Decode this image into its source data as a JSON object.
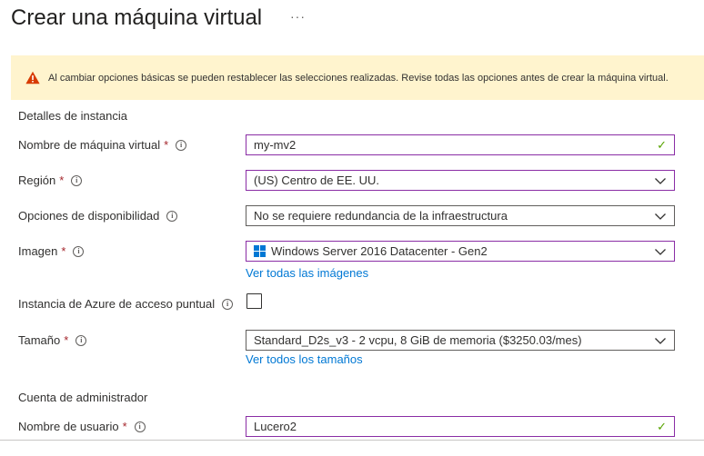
{
  "page": {
    "title": "Crear una máquina virtual",
    "more_label": "···"
  },
  "warning": {
    "text": "Al cambiar opciones básicas se pueden restablecer las selecciones realizadas. Revise todas las opciones antes de crear la máquina virtual.",
    "icon": "warning-icon",
    "background_color": "#fff4ce",
    "icon_color": "#d83b01"
  },
  "instance_details": {
    "section_title": "Detalles de instancia",
    "vm_name": {
      "label": "Nombre de máquina virtual",
      "required": "*",
      "value": "my-mv2",
      "validated": true
    },
    "region": {
      "label": "Región",
      "required": "*",
      "value": "(US) Centro de EE. UU."
    },
    "availability": {
      "label": "Opciones de disponibilidad",
      "value": "No se requiere redundancia de la infraestructura"
    },
    "image": {
      "label": "Imagen",
      "required": "*",
      "value": "Windows Server 2016 Datacenter - Gen2",
      "link": "Ver todas las imágenes"
    },
    "spot": {
      "label": "Instancia de Azure de acceso puntual",
      "checked": false
    },
    "size": {
      "label": "Tamaño",
      "required": "*",
      "value": "Standard_D2s_v3 - 2 vcpu, 8 GiB de memoria ($3250.03/mes)",
      "link": "Ver todos los tamaños"
    }
  },
  "admin_account": {
    "section_title": "Cuenta de administrador",
    "username": {
      "label": "Nombre de usuario",
      "required": "*",
      "value": "Lucero2",
      "validated": true
    }
  },
  "colors": {
    "accent_link": "#0078d4",
    "active_border": "#8a2da5",
    "required": "#a4262c",
    "valid_check": "#57a300"
  }
}
